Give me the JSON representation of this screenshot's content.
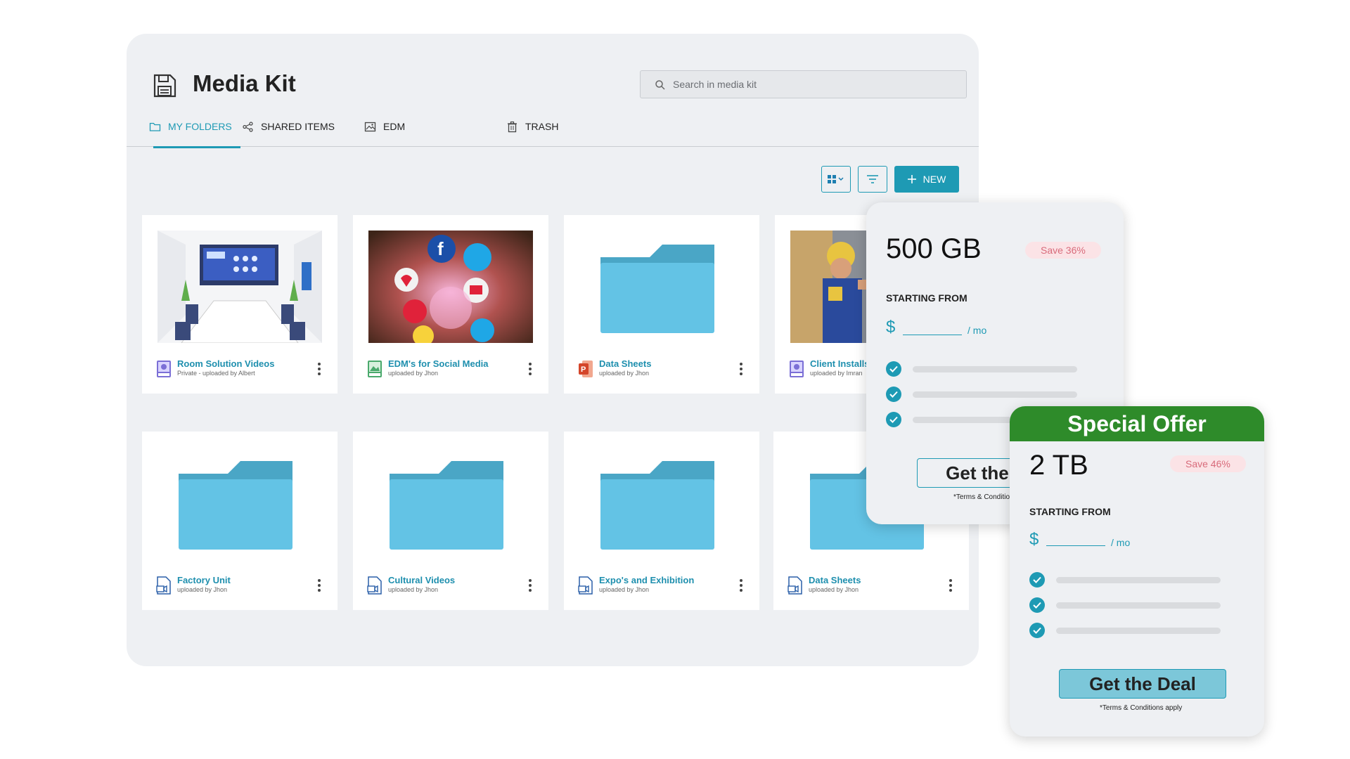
{
  "app": {
    "title": "Media Kit",
    "search_placeholder": "Search in media kit"
  },
  "tabs": [
    {
      "label": "MY FOLDERS",
      "active": true,
      "icon": "folder-icon"
    },
    {
      "label": "SHARED ITEMS",
      "active": false,
      "icon": "share-icon"
    },
    {
      "label": "EDM",
      "active": false,
      "icon": "image-icon"
    },
    {
      "label": "TRASH",
      "active": false,
      "icon": "trash-icon"
    }
  ],
  "toolbar": {
    "view_icon": "grid-view-icon",
    "filter_icon": "filter-icon",
    "new_label": "NEW"
  },
  "cards": [
    {
      "name": "Room Solution Videos",
      "sub": "Private - uploaded by Albert",
      "type": "video-image"
    },
    {
      "name": "EDM's for Social Media",
      "sub": "uploaded by Jhon",
      "type": "social-image"
    },
    {
      "name": "Data Sheets",
      "sub": "uploaded by Jhon",
      "type": "folder"
    },
    {
      "name": "Client Installs",
      "sub": "uploaded by Imran",
      "type": "worker-image"
    },
    {
      "name": "Factory Unit",
      "sub": "uploaded by Jhon",
      "type": "folder"
    },
    {
      "name": "Cultural Videos",
      "sub": "uploaded by Jhon",
      "type": "folder"
    },
    {
      "name": "Expo's and Exhibition",
      "sub": "uploaded by Jhon",
      "type": "folder"
    },
    {
      "name": "Data Sheets",
      "sub": "uploaded by Jhon",
      "type": "folder"
    }
  ],
  "plans": [
    {
      "amount": "500 GB",
      "save": "Save 36%",
      "starting": "STARTING FROM",
      "currency": "$",
      "per": "/ mo",
      "button": "Get the Deal",
      "terms": "*Terms & Conditions apply"
    },
    {
      "banner": "Special Offer",
      "amount": "2 TB",
      "save": "Save 46%",
      "starting": "STARTING FROM",
      "currency": "$",
      "per": "/ mo",
      "button": "Get the Deal",
      "terms": "*Terms & Conditions apply"
    }
  ],
  "colors": {
    "accent": "#1e9ab4",
    "folder": "#63c3e5",
    "folder_tab": "#4aa6c6",
    "offer_green": "#2e8b2a",
    "save_badge": "#fbe3e6"
  }
}
